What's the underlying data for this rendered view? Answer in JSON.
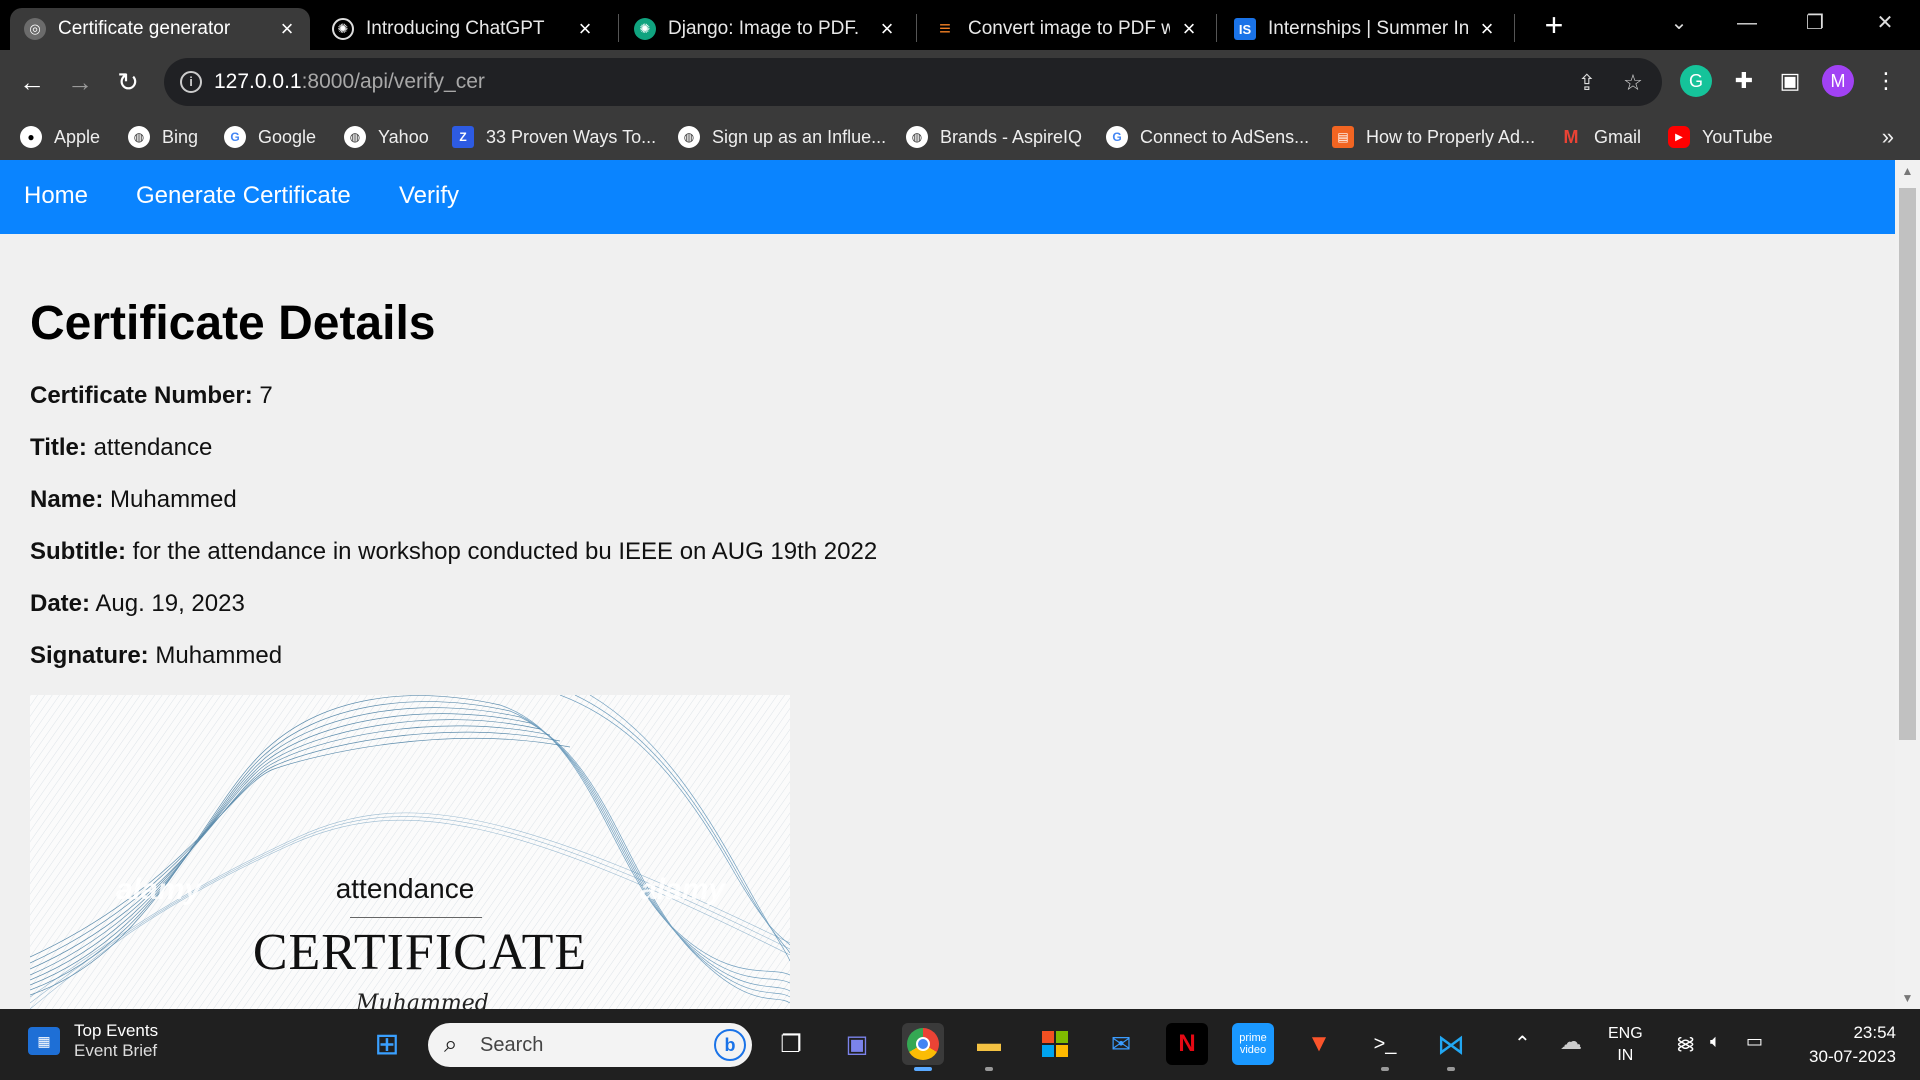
{
  "browser": {
    "tabs": [
      {
        "title": "Certificate generator",
        "favicon_color": "#6b6b6b",
        "active": true
      },
      {
        "title": "Introducing ChatGPT",
        "favicon_color": "#000000",
        "active": false
      },
      {
        "title": "Django: Image to PDF.",
        "favicon_color": "#10a37f",
        "active": false
      },
      {
        "title": "Convert image to PDF wit",
        "favicon_color": "#f48024",
        "active": false
      },
      {
        "title": "Internships | Summer Inte",
        "favicon_color": "#1a73e8",
        "favicon_text": "IS",
        "active": false
      }
    ],
    "address": {
      "host": "127.0.0.1",
      "path": ":8000/api/verify_cer"
    },
    "profile_initial": "M",
    "bookmarks": [
      {
        "label": "Apple",
        "color": "#ffffff"
      },
      {
        "label": "Bing",
        "color": "#ffffff"
      },
      {
        "label": "Google",
        "color": "#ffffff"
      },
      {
        "label": "Yahoo",
        "color": "#ffffff"
      },
      {
        "label": "33 Proven Ways To...",
        "color": "#2d5be3"
      },
      {
        "label": "Sign up as an Influe...",
        "color": "#ffffff"
      },
      {
        "label": "Brands - AspireIQ",
        "color": "#ffffff"
      },
      {
        "label": "Connect to AdSens...",
        "color": "#ffffff"
      },
      {
        "label": "How to Properly Ad...",
        "color": "#f26522"
      },
      {
        "label": "Gmail",
        "color": "#ea4335"
      },
      {
        "label": "YouTube",
        "color": "#ff0000"
      }
    ]
  },
  "site": {
    "nav": [
      "Home",
      "Generate Certificate",
      "Verify"
    ],
    "accent": "#0a84ff",
    "heading": "Certificate Details",
    "fields": [
      {
        "label": "Certificate Number:",
        "value": "7"
      },
      {
        "label": "Title:",
        "value": "attendance"
      },
      {
        "label": "Name:",
        "value": "Muhammed"
      },
      {
        "label": "Subtitle:",
        "value": "for the attendance in workshop conducted bu IEEE on AUG 19th 2022"
      },
      {
        "label": "Date:",
        "value": "Aug. 19, 2023"
      },
      {
        "label": "Signature:",
        "value": "Muhammed"
      }
    ],
    "certificate_image": {
      "title": "attendance",
      "heading": "CERTIFICATE",
      "signature": "Muhammed",
      "watermark": "alamy"
    }
  },
  "taskbar": {
    "widget_title": "Top Events",
    "widget_subtitle": "Event Brief",
    "search_placeholder": "Search",
    "language": "ENG",
    "region": "IN",
    "time": "23:54",
    "date": "30-07-2023"
  }
}
